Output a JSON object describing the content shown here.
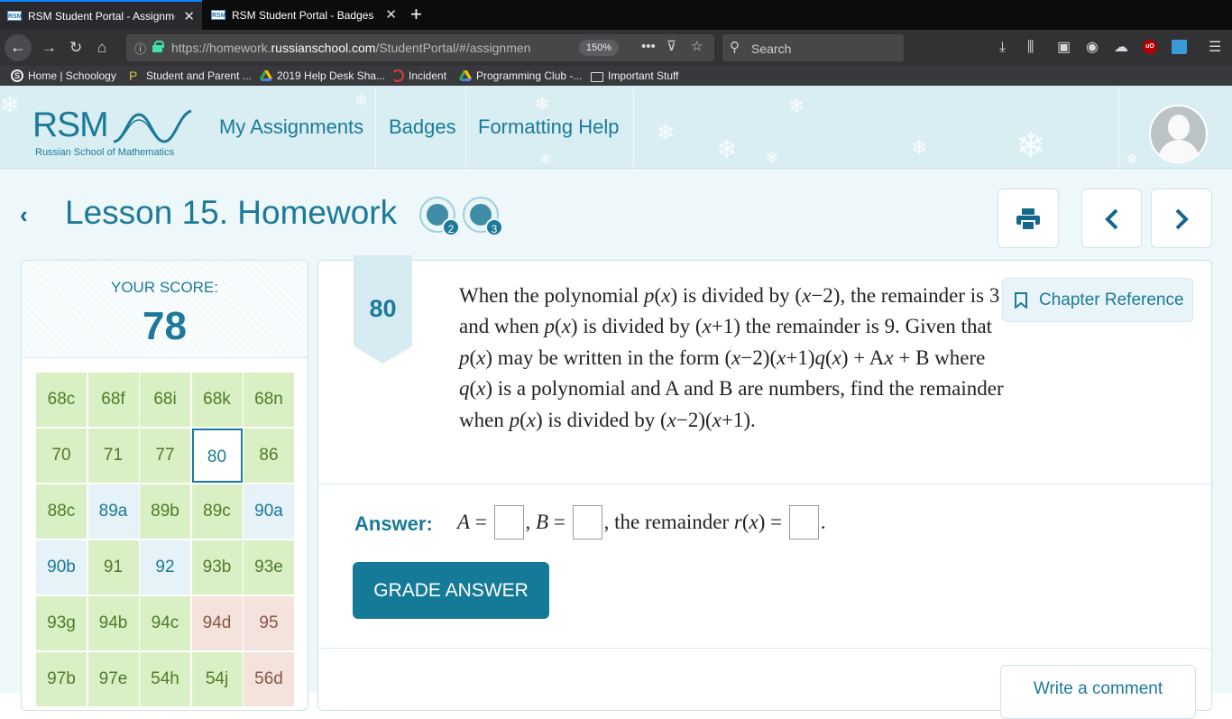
{
  "browser": {
    "tabs": [
      {
        "favicon": "RSM",
        "title": "RSM Student Portal - Assignme",
        "active": true
      },
      {
        "favicon": "RSM",
        "title": "RSM Student Portal - Badges",
        "active": false
      }
    ],
    "url_prefix": "https://homework.",
    "url_domain": "russianschool.com",
    "url_path": "/StudentPortal/#/assignmen",
    "zoom": "150%",
    "search_placeholder": "Search",
    "bookmarks": [
      {
        "label": "Home | Schoology",
        "icon": "schoology-icon"
      },
      {
        "label": "Student and Parent ...",
        "icon": "p-flag-icon"
      },
      {
        "label": "2019 Help Desk Sha...",
        "icon": "google-drive-icon"
      },
      {
        "label": "Incident",
        "icon": "servicenow-icon"
      },
      {
        "label": "Programming Club -...",
        "icon": "google-drive-icon"
      },
      {
        "label": "Important Stuff",
        "icon": "folder-icon"
      }
    ]
  },
  "site": {
    "logo_text": "RSM",
    "logo_subtitle": "Russian School of Mathematics",
    "nav": [
      "My Assignments",
      "Badges",
      "Formatting Help"
    ]
  },
  "lesson": {
    "title": "Lesson 15. Homework",
    "badges": [
      {
        "icon": "hand-badge-icon",
        "count": "2"
      },
      {
        "icon": "books-badge-icon",
        "count": "3"
      }
    ]
  },
  "score": {
    "label": "YOUR SCORE:",
    "value": "78",
    "problems": [
      {
        "id": "68c",
        "state": "correct"
      },
      {
        "id": "68f",
        "state": "correct"
      },
      {
        "id": "68i",
        "state": "correct"
      },
      {
        "id": "68k",
        "state": "correct"
      },
      {
        "id": "68n",
        "state": "correct"
      },
      {
        "id": "70",
        "state": "correct"
      },
      {
        "id": "71",
        "state": "correct"
      },
      {
        "id": "77",
        "state": "correct"
      },
      {
        "id": "80",
        "state": "current"
      },
      {
        "id": "86",
        "state": "correct"
      },
      {
        "id": "88c",
        "state": "correct"
      },
      {
        "id": "89a",
        "state": "unanswered"
      },
      {
        "id": "89b",
        "state": "correct"
      },
      {
        "id": "89c",
        "state": "correct"
      },
      {
        "id": "90a",
        "state": "unanswered"
      },
      {
        "id": "90b",
        "state": "unanswered"
      },
      {
        "id": "91",
        "state": "correct"
      },
      {
        "id": "92",
        "state": "unanswered"
      },
      {
        "id": "93b",
        "state": "correct"
      },
      {
        "id": "93e",
        "state": "correct"
      },
      {
        "id": "93g",
        "state": "correct"
      },
      {
        "id": "94b",
        "state": "correct"
      },
      {
        "id": "94c",
        "state": "correct"
      },
      {
        "id": "94d",
        "state": "wrong"
      },
      {
        "id": "95",
        "state": "wrong"
      },
      {
        "id": "97b",
        "state": "correct"
      },
      {
        "id": "97e",
        "state": "correct"
      },
      {
        "id": "54h",
        "state": "correct"
      },
      {
        "id": "54j",
        "state": "correct"
      },
      {
        "id": "56d",
        "state": "wrong"
      }
    ]
  },
  "problem": {
    "number": "80",
    "chapter_reference": "Chapter Reference",
    "answer_label": "Answer:",
    "grade_button": "GRADE ANSWER",
    "comment_button": "Write a comment"
  },
  "colors": {
    "accent": "#1b7a99",
    "button": "#157a98",
    "correct": "#d9f0c4",
    "unanswered": "#e5f2f7",
    "wrong": "#f4e2dc"
  }
}
